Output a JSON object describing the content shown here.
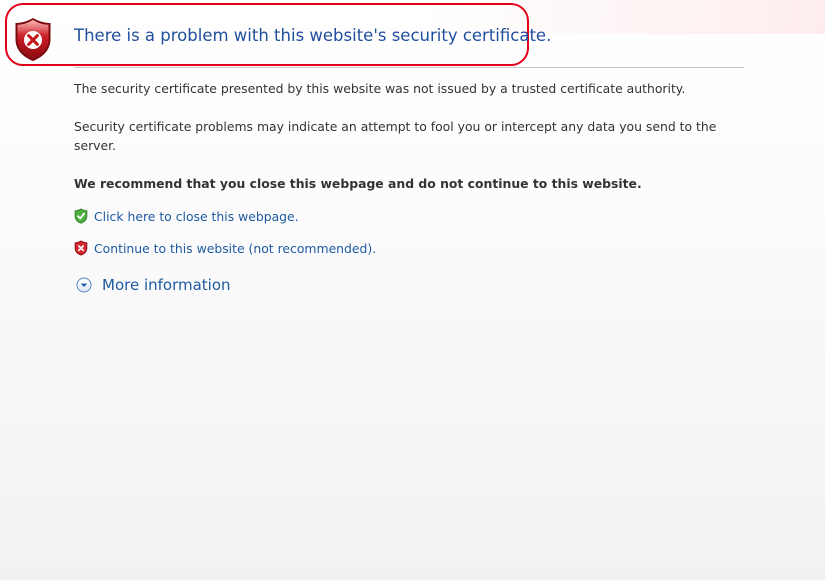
{
  "header": {
    "title": "There is a problem with this website's security certificate.",
    "icon": "shield-error-icon"
  },
  "messages": {
    "issuer": "The security certificate presented by this website was not issued by a trusted certificate authority.",
    "warning": "Security certificate problems may indicate an attempt to fool you or intercept any data you send to the server.",
    "recommendation": "We recommend that you close this webpage and do not continue to this website."
  },
  "actions": {
    "close": {
      "label": "Click here to close this webpage.",
      "icon": "shield-check-icon"
    },
    "continue": {
      "label": "Continue to this website (not recommended).",
      "icon": "shield-error-small-icon"
    },
    "more_info": {
      "label": "More information",
      "icon": "expand-circle-icon"
    }
  },
  "colors": {
    "title": "#1f4e9d",
    "link": "#1f5aa0",
    "body_text": "#333333",
    "highlight": "#e3001b",
    "shield_red": "#c4161c",
    "shield_green": "#3c9a2f"
  }
}
